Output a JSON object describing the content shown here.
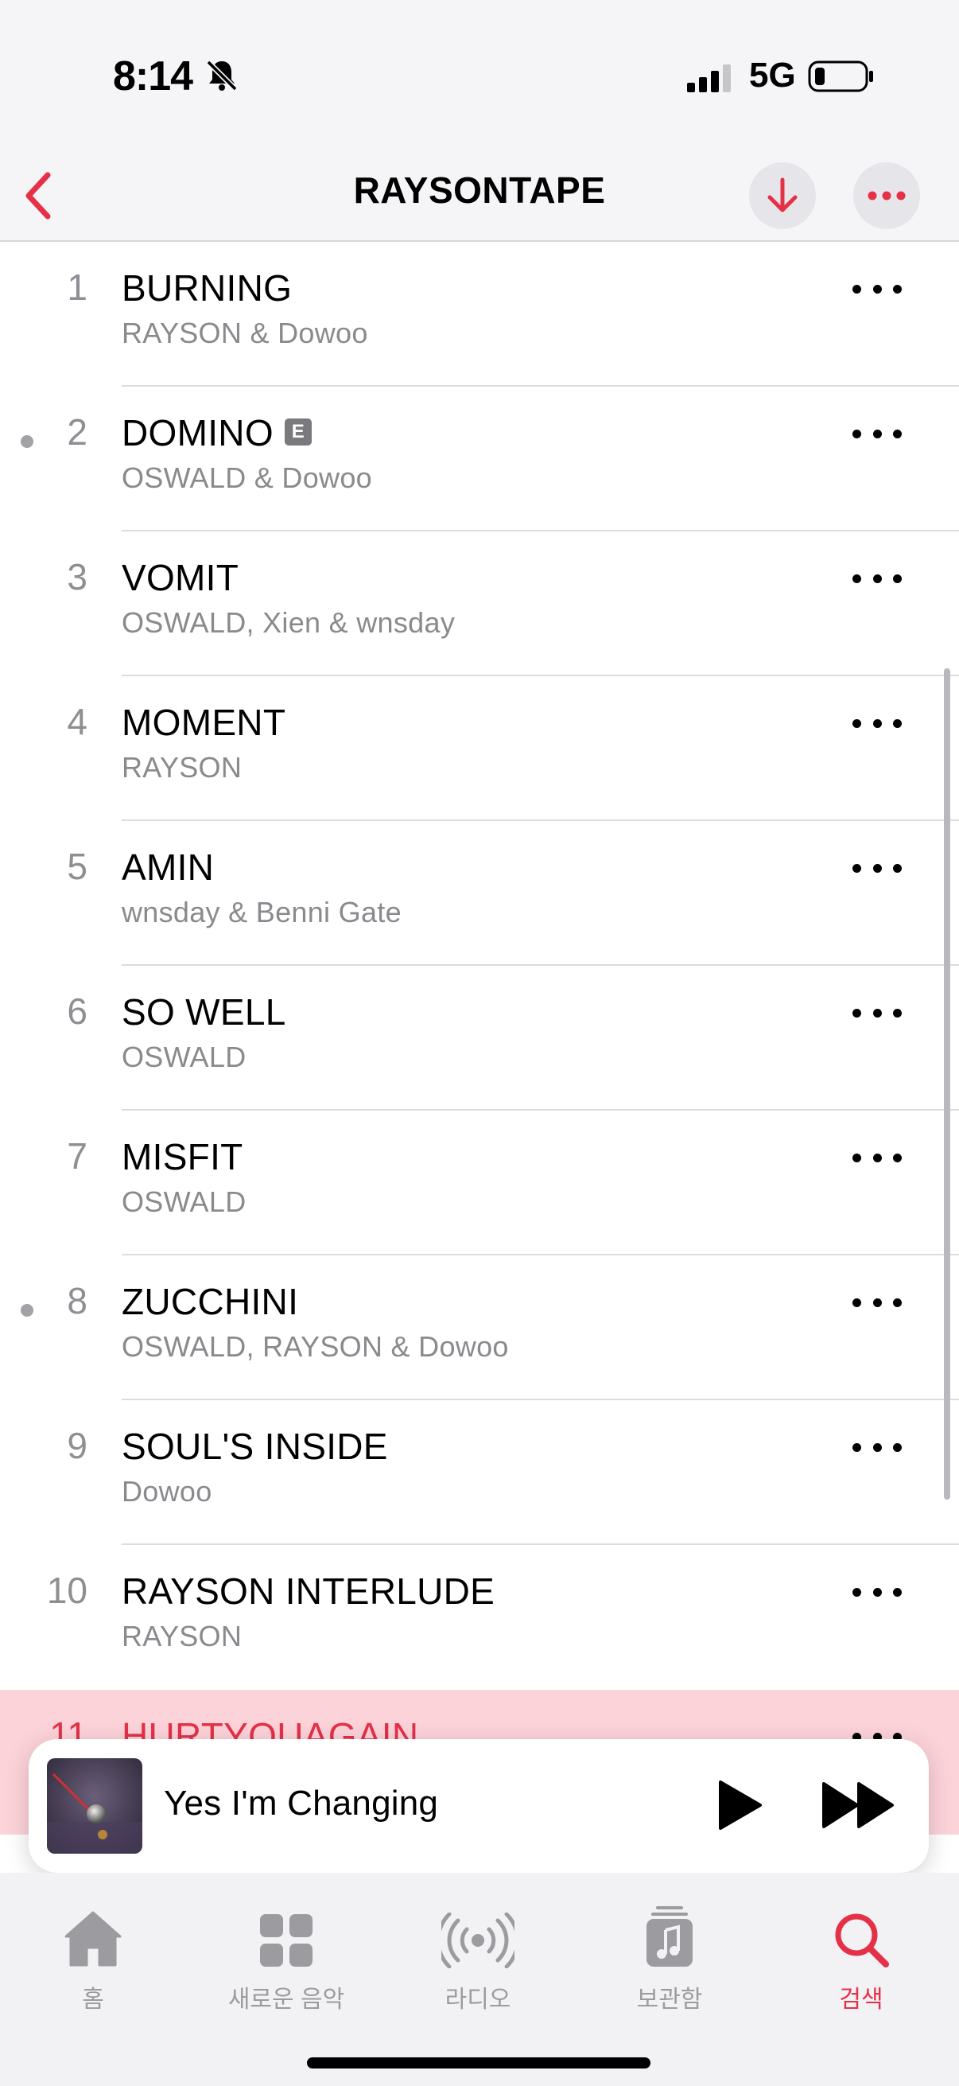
{
  "status": {
    "time": "8:14",
    "network": "5G"
  },
  "nav": {
    "title": "RAYSONTAPE"
  },
  "tracks": [
    {
      "number": "1",
      "title": "BURNING",
      "artist": "RAYSON & Dowoo",
      "explicit": false,
      "dot": false
    },
    {
      "number": "2",
      "title": "DOMINO",
      "artist": "OSWALD & Dowoo",
      "explicit": true,
      "dot": true
    },
    {
      "number": "3",
      "title": "VOMIT",
      "artist": "OSWALD, Xien & wnsday",
      "explicit": false,
      "dot": false
    },
    {
      "number": "4",
      "title": "MOMENT",
      "artist": "RAYSON",
      "explicit": false,
      "dot": false
    },
    {
      "number": "5",
      "title": "AMIN",
      "artist": "wnsday & Benni Gate",
      "explicit": false,
      "dot": false
    },
    {
      "number": "6",
      "title": "SO WELL",
      "artist": "OSWALD",
      "explicit": false,
      "dot": false
    },
    {
      "number": "7",
      "title": "MISFIT",
      "artist": "OSWALD",
      "explicit": false,
      "dot": false
    },
    {
      "number": "8",
      "title": "ZUCCHINI",
      "artist": "OSWALD, RAYSON & Dowoo",
      "explicit": false,
      "dot": true
    },
    {
      "number": "9",
      "title": "SOUL'S INSIDE",
      "artist": "Dowoo",
      "explicit": false,
      "dot": false
    },
    {
      "number": "10",
      "title": "RAYSON INTERLUDE",
      "artist": "RAYSON",
      "explicit": false,
      "dot": false
    },
    {
      "number": "11",
      "title": "HURTYOUAGAIN",
      "artist": "",
      "explicit": false,
      "dot": false,
      "playing": true
    }
  ],
  "explicit_badge": "E",
  "mini_player": {
    "title": "Yes I'm Changing"
  },
  "tabs": [
    {
      "label": "홈",
      "icon": "home-icon"
    },
    {
      "label": "새로운 음악",
      "icon": "grid-icon"
    },
    {
      "label": "라디오",
      "icon": "radio-icon"
    },
    {
      "label": "보관함",
      "icon": "library-icon"
    },
    {
      "label": "검색",
      "icon": "search-icon",
      "active": true
    }
  ],
  "colors": {
    "accent": "#e53148",
    "highlight": "#fdd3da"
  }
}
